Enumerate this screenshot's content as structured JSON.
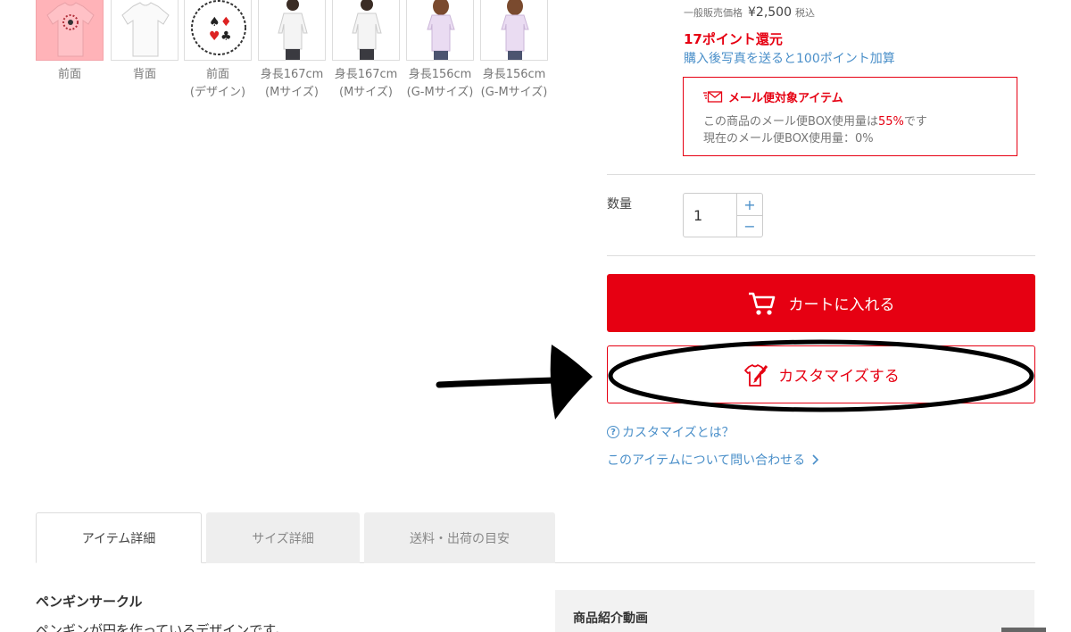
{
  "thumbnails": [
    {
      "caption": "前面",
      "kind": "design-front",
      "selected": true
    },
    {
      "caption": "背面",
      "kind": "plain-back",
      "selected": false
    },
    {
      "caption": "前面\n(デザイン)",
      "kind": "design-art",
      "selected": false
    },
    {
      "caption": "身長167cm\n(Mサイズ)",
      "kind": "model-male",
      "selected": false
    },
    {
      "caption": "身長167cm\n(Mサイズ)",
      "kind": "model-male",
      "selected": false
    },
    {
      "caption": "身長156cm\n(G-Mサイズ)",
      "kind": "model-female",
      "selected": false
    },
    {
      "caption": "身長156cm\n(G-Mサイズ)",
      "kind": "model-female",
      "selected": false
    }
  ],
  "pricing": {
    "general_label": "一般販売価格",
    "price": "¥2,500",
    "tax": "税込",
    "points": "17ポイント還元",
    "photo_bonus": "購入後写真を送ると100ポイント加算"
  },
  "mailbox": {
    "title": "メール便対象アイテム",
    "usage_prefix": "この商品のメール便BOX使用量は",
    "usage_pct": "55%",
    "usage_suffix": "です",
    "current": "現在のメール便BOX使用量：0%"
  },
  "quantity": {
    "label": "数量",
    "value": "1",
    "plus": "+",
    "minus": "−"
  },
  "buttons": {
    "cart": "カートに入れる",
    "customize": "カスタマイズする"
  },
  "links": {
    "whatis": "カスタマイズとは？",
    "inquiry": "このアイテムについて問い合わせる"
  },
  "tabs": [
    {
      "label": "アイテム詳細",
      "active": true
    },
    {
      "label": "サイズ詳細",
      "active": false
    },
    {
      "label": "送料・出荷の目安",
      "active": false
    }
  ],
  "detail": {
    "title": "ペンギンサークル",
    "description": "ペンギンが円を作っているデザインです。",
    "video_title": "商品紹介動画"
  },
  "colors": {
    "accent_red": "#e60012",
    "link_blue": "#4a8fc9"
  },
  "icons": [
    "cart-icon",
    "customize-shirt-icon",
    "mail-icon",
    "question-icon",
    "chevron-right-icon",
    "plus-icon",
    "minus-icon"
  ]
}
